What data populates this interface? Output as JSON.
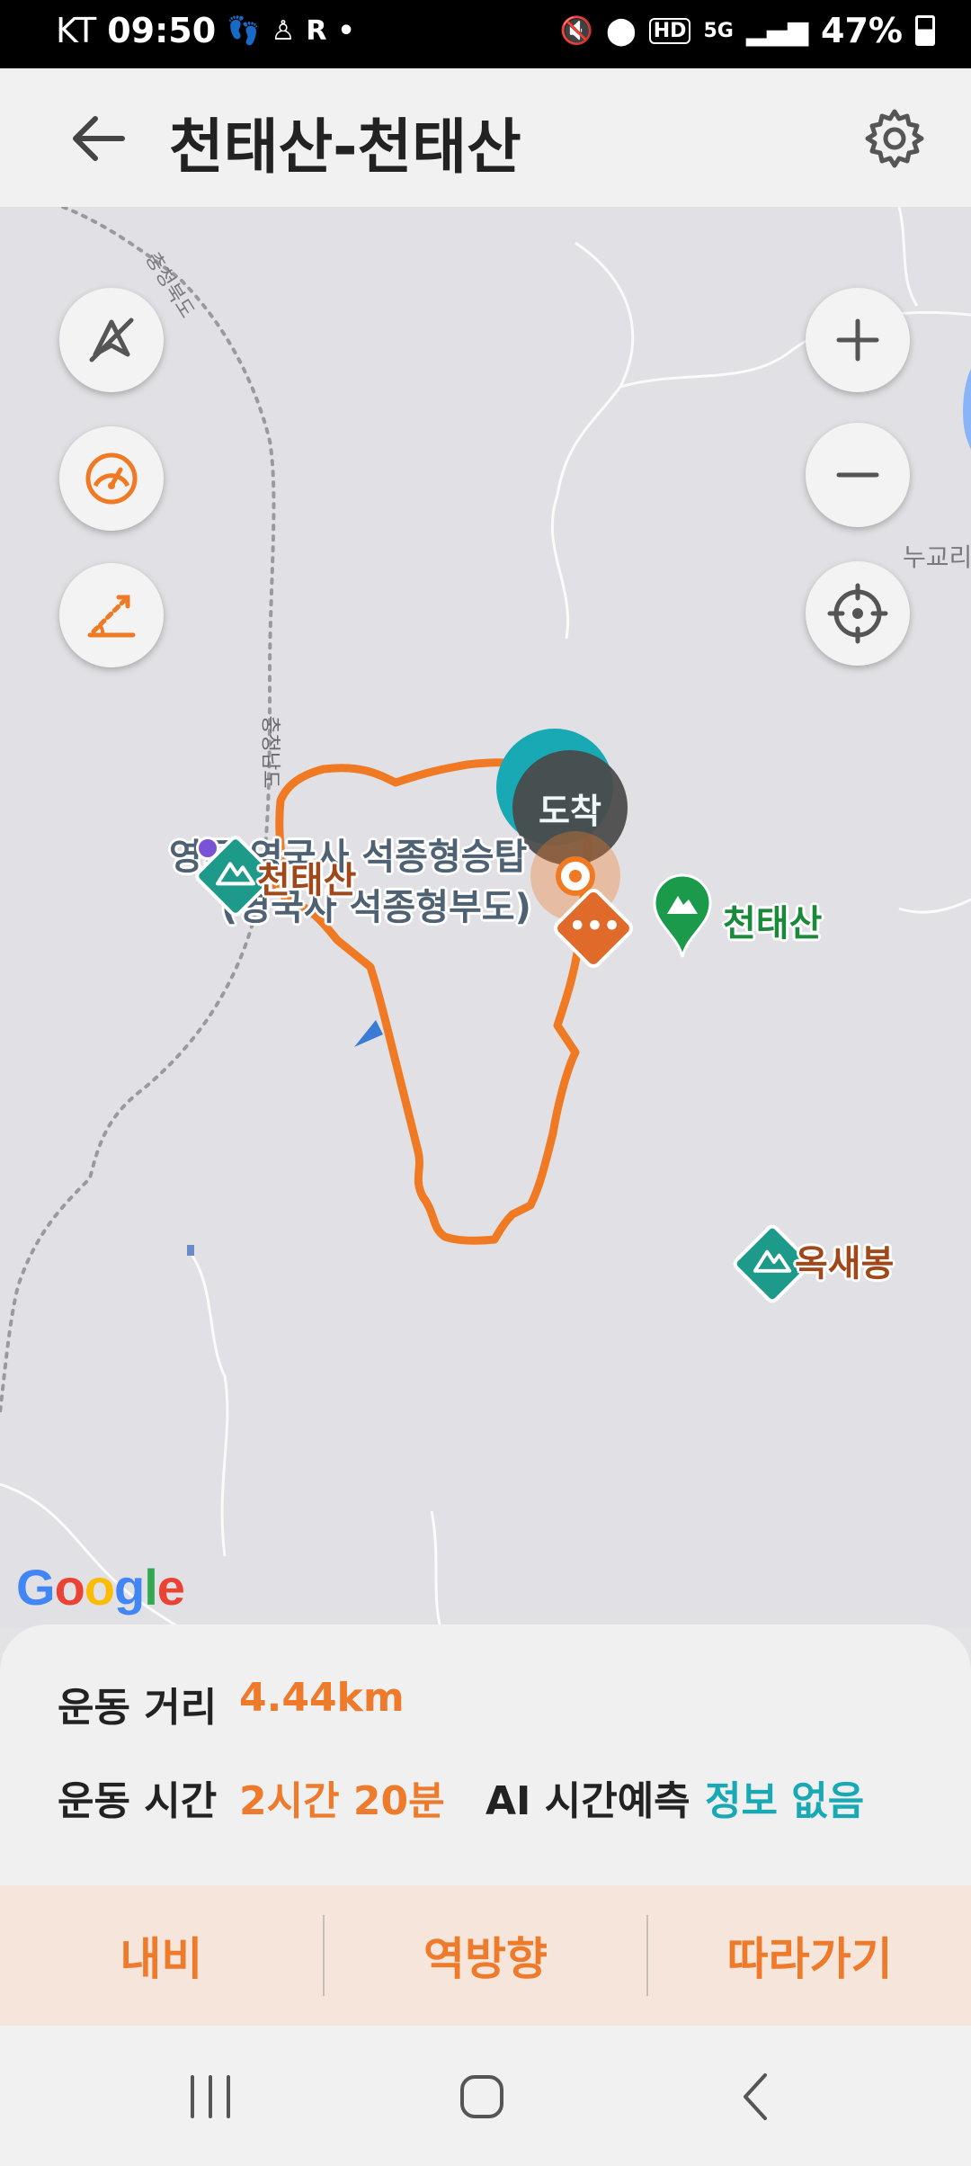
{
  "status_bar": {
    "carrier": "KT",
    "time": "09:50",
    "extra_glyph": "R",
    "hd": "HD",
    "network": "5G",
    "battery": "47%"
  },
  "header": {
    "title": "천태산-천태산",
    "back_icon": "arrow-left-icon",
    "settings_icon": "gear-icon"
  },
  "map": {
    "controls_left": [
      "compass-off-icon",
      "speedometer-icon",
      "slope-icon"
    ],
    "controls_right": [
      "zoom-in-icon",
      "zoom-out-icon",
      "my-location-icon"
    ],
    "labels": {
      "arrival": "도착",
      "temple_line1": "영국사 석종형승탑",
      "temple_line2": "(영국사 석종형부도)",
      "temple_prefix": "영국",
      "peak_cheontae_red": "천태산",
      "peak_cheontae_green": "천태산",
      "peak_oksae": "옥새봉",
      "border_upper": "충청북도",
      "border_lower": "충청남도",
      "nugyo": "누교리"
    },
    "google_logo": "Google",
    "route_color": "#f07a24"
  },
  "info": {
    "distance_label": "운동 거리",
    "distance_value": "4.44km",
    "time_label": "운동 시간",
    "time_value": "2시간 20분",
    "ai_label": "AI 시간예측",
    "ai_value": "정보 없음"
  },
  "actions": {
    "navigate": "내비",
    "reverse": "역방향",
    "follow": "따라가기"
  },
  "nav": [
    "recent-apps-icon",
    "home-icon",
    "back-icon"
  ],
  "colors": {
    "accent": "#ee7a2b",
    "teal": "#19a9b5",
    "peak_green": "#1a8a3a"
  }
}
